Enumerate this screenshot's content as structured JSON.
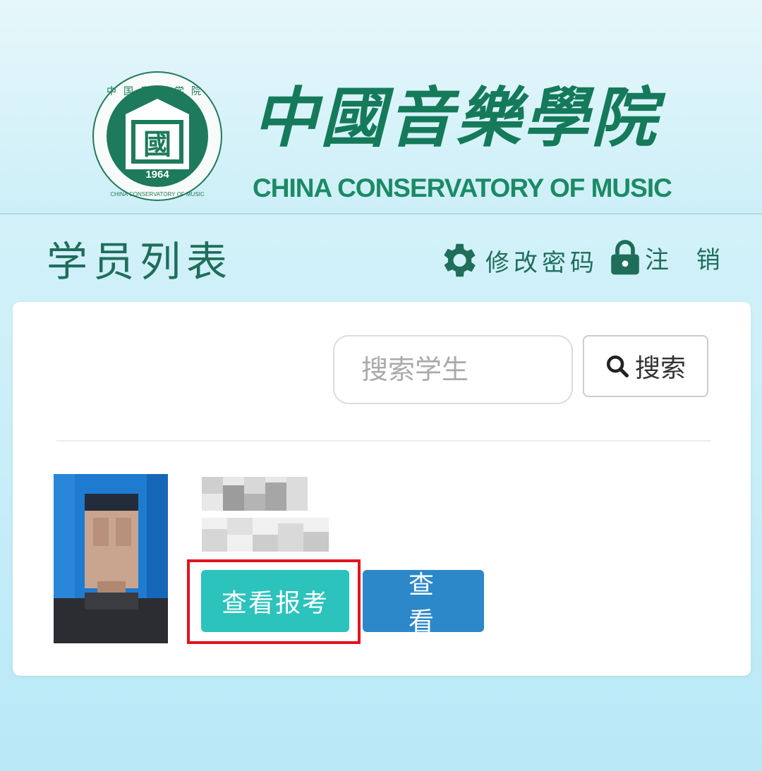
{
  "header": {
    "brand_cn": "中國音樂學院",
    "brand_en": "CHINA CONSERVATORY OF MUSIC",
    "seal": {
      "year": "1964",
      "ring_text": "CHINA CONSERVATORY OF MUSIC",
      "top_text": "中国音乐学院",
      "center_glyph": "國"
    }
  },
  "toolbar": {
    "title": "学员列表",
    "change_password_label": "修改密码",
    "logout_label": "注 销"
  },
  "search": {
    "placeholder": "搜索学生",
    "button_label": "搜索"
  },
  "student": {
    "view_exam_label": "查看报考",
    "view_label": "查 看"
  },
  "colors": {
    "brand_green": "#157a5a",
    "title_green": "#1e6e5a",
    "exam_button": "#2bc3bc",
    "view_button": "#2c88c9",
    "highlight": "#e3141e"
  }
}
